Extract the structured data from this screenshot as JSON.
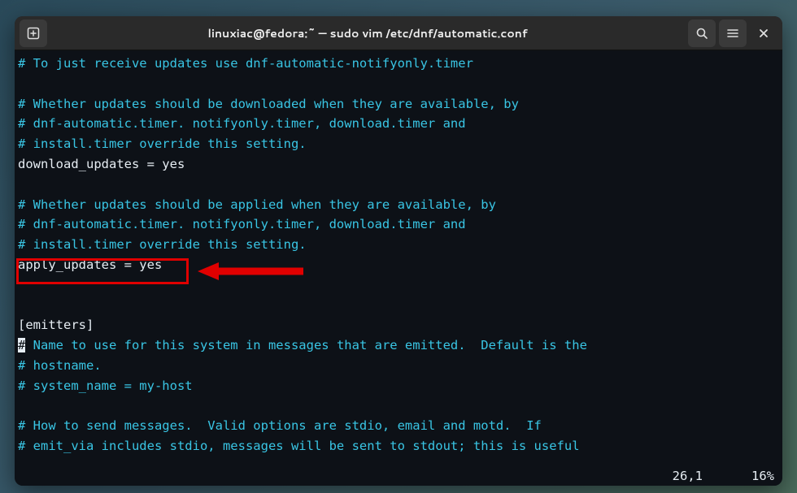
{
  "titlebar": {
    "title": "linuxiac@fedora:~ — sudo vim /etc/dnf/automatic.conf"
  },
  "editor": {
    "lines": [
      {
        "cls": "comment",
        "text": "# To just receive updates use dnf-automatic-notifyonly.timer"
      },
      {
        "cls": "plain",
        "text": ""
      },
      {
        "cls": "comment",
        "text": "# Whether updates should be downloaded when they are available, by"
      },
      {
        "cls": "comment",
        "text": "# dnf-automatic.timer. notifyonly.timer, download.timer and"
      },
      {
        "cls": "comment",
        "text": "# install.timer override this setting."
      },
      {
        "cls": "plain",
        "text": "download_updates = yes"
      },
      {
        "cls": "plain",
        "text": ""
      },
      {
        "cls": "comment",
        "text": "# Whether updates should be applied when they are available, by"
      },
      {
        "cls": "comment",
        "text": "# dnf-automatic.timer. notifyonly.timer, download.timer and"
      },
      {
        "cls": "comment",
        "text": "# install.timer override this setting."
      },
      {
        "cls": "plain",
        "text": "apply_updates = yes"
      },
      {
        "cls": "plain",
        "text": ""
      },
      {
        "cls": "plain",
        "text": ""
      },
      {
        "cls": "section",
        "text": "[emitters]"
      },
      {
        "cls": "comment",
        "text": "# Name to use for this system in messages that are emitted.  Default is the",
        "cursor0": true
      },
      {
        "cls": "comment",
        "text": "# hostname."
      },
      {
        "cls": "comment",
        "text": "# system_name = my-host"
      },
      {
        "cls": "plain",
        "text": ""
      },
      {
        "cls": "comment",
        "text": "# How to send messages.  Valid options are stdio, email and motd.  If"
      },
      {
        "cls": "comment",
        "text": "# emit_via includes stdio, messages will be sent to stdout; this is useful"
      }
    ]
  },
  "statusbar": {
    "position": "26,1",
    "percent": "16%"
  }
}
